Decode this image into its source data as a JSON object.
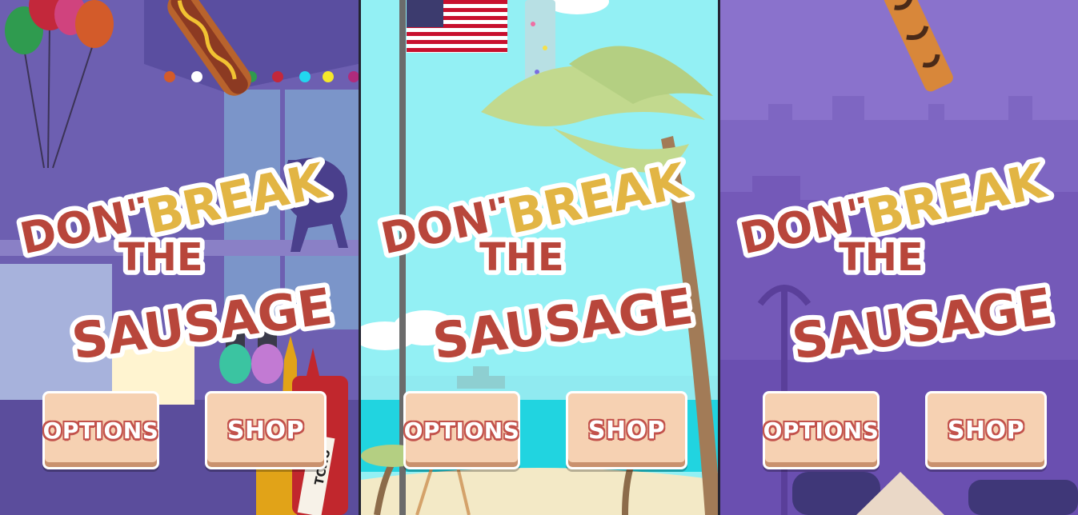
{
  "screens": [
    {
      "theme": "carnival",
      "title": {
        "line1_a": "DON'T",
        "line1_b": "BREAK",
        "line2": "THE",
        "line3": "SAUSAGE"
      },
      "buttons": {
        "options": "OPTIONS",
        "shop": "SHOP"
      },
      "bottle_text": "TCHU"
    },
    {
      "theme": "beach",
      "title": {
        "line1_a": "DON'T",
        "line1_b": "BREAK",
        "line2": "THE",
        "line3": "SAUSAGE"
      },
      "buttons": {
        "options": "OPTIONS",
        "shop": "SHOP"
      }
    },
    {
      "theme": "city",
      "title": {
        "line1_a": "DON'T",
        "line1_b": "BREAK",
        "line2": "THE",
        "line3": "SAUSAGE"
      },
      "buttons": {
        "options": "OPTIONS",
        "shop": "SHOP"
      }
    }
  ],
  "colors": {
    "title_red": "#b8463b",
    "title_gold": "#e2b544",
    "button_fill": "#f6d1b2",
    "button_text_outline": "#c2514b"
  }
}
